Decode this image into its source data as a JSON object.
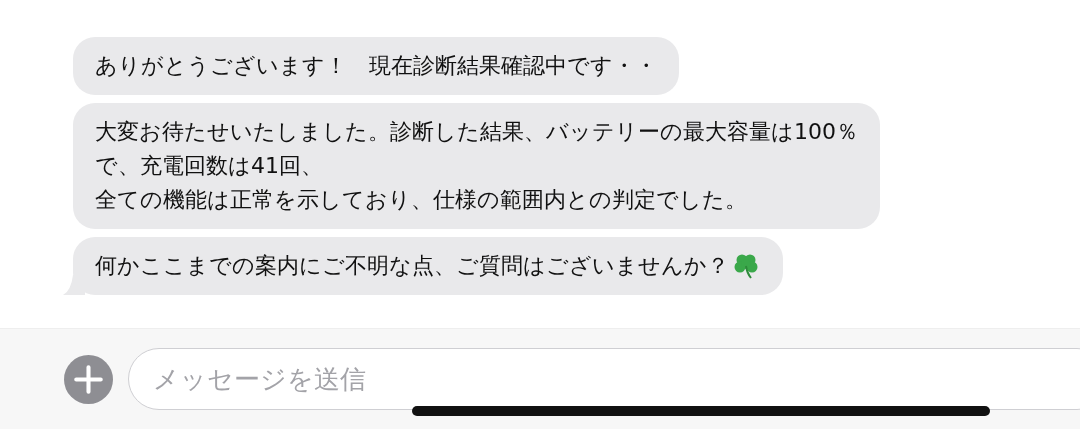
{
  "messages": [
    {
      "lines": [
        "ありがとうございます！　現在診断結果確認中です・・"
      ],
      "emoji": false,
      "tail": false
    },
    {
      "lines": [
        "大変お待たせいたしました。診断した結果、バッテリーの最大容量は100％",
        "で、充電回数は41回、",
        "全ての機能は正常を示しており、仕様の範囲内との判定でした。"
      ],
      "emoji": false,
      "tail": false
    },
    {
      "lines": [
        "何かここまでの案内にご不明な点、ご質問はございませんか？"
      ],
      "emoji": true,
      "tail": true
    }
  ],
  "composer": {
    "placeholder": "メッセージを送信"
  }
}
